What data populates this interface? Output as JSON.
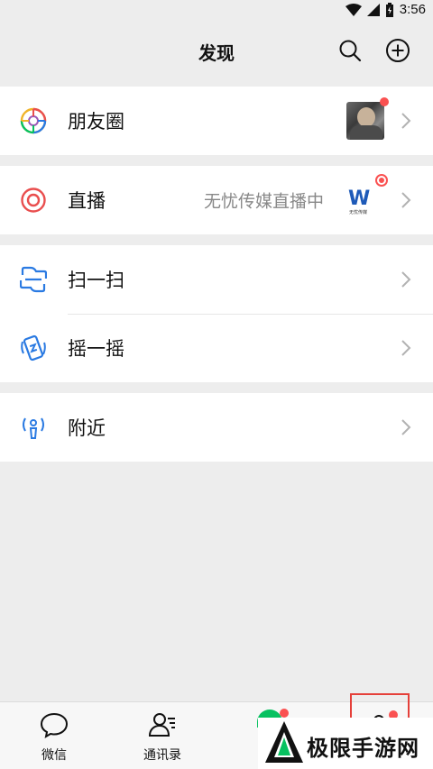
{
  "status_bar": {
    "time": "3:56"
  },
  "header": {
    "title": "发现"
  },
  "discover_items": {
    "moments": {
      "label": "朋友圈"
    },
    "live": {
      "label": "直播",
      "subtitle": "无忧传媒直播中",
      "logo_text": "无忧传媒"
    },
    "scan": {
      "label": "扫一扫"
    },
    "shake": {
      "label": "摇一摇"
    },
    "nearby": {
      "label": "附近"
    }
  },
  "tab_bar": {
    "tabs": [
      {
        "label": "微信"
      },
      {
        "label": "通讯录"
      },
      {
        "label": ""
      },
      {
        "label": ""
      }
    ]
  },
  "watermark": {
    "text": "极限手游网"
  },
  "colors": {
    "background": "#ededed",
    "accent_green": "#07c160",
    "badge_red": "#fa5151",
    "icon_blue": "#2a7ae2",
    "live_red": "#e94e4e"
  }
}
